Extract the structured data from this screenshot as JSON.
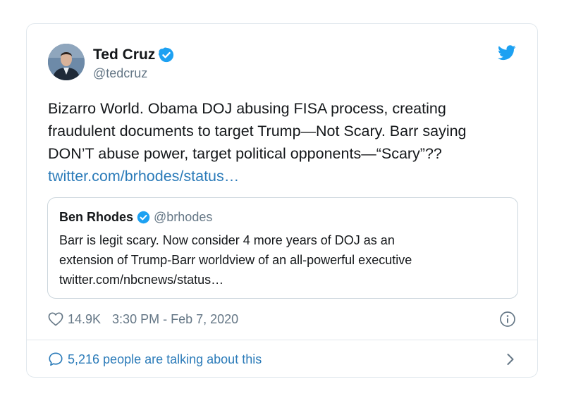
{
  "author": {
    "name": "Ted Cruz",
    "handle": "@tedcruz",
    "verified": true
  },
  "tweet": {
    "lines": [
      "Bizarro World.  Obama DOJ abusing FISA process, creating",
      "fraudulent documents to target Trump—Not Scary. Barr saying",
      "DON’T abuse power, target political opponents—“Scary”??"
    ],
    "link": "twitter.com/brhodes/status…"
  },
  "quoted": {
    "name": "Ben Rhodes",
    "handle": "@brhodes",
    "verified": true,
    "lines": [
      "Barr is legit scary. Now consider 4 more years of DOJ as an",
      "extension of Trump-Barr worldview of an all-powerful executive",
      "twitter.com/nbcnews/status…"
    ]
  },
  "meta": {
    "likes": "14.9K",
    "timestamp": "3:30 PM - Feb 7, 2020"
  },
  "footer": {
    "talking": "5,216 people are talking about this"
  },
  "icons": {
    "verified": "verified-badge-icon",
    "bird": "twitter-bird-icon",
    "heart": "heart-icon",
    "info": "info-icon",
    "bubble": "speech-bubble-icon",
    "chevron": "chevron-right-icon"
  },
  "colors": {
    "accent": "#1da1f2",
    "link": "#2b7bb9",
    "muted": "#657786",
    "border": "#e1e8ed"
  }
}
